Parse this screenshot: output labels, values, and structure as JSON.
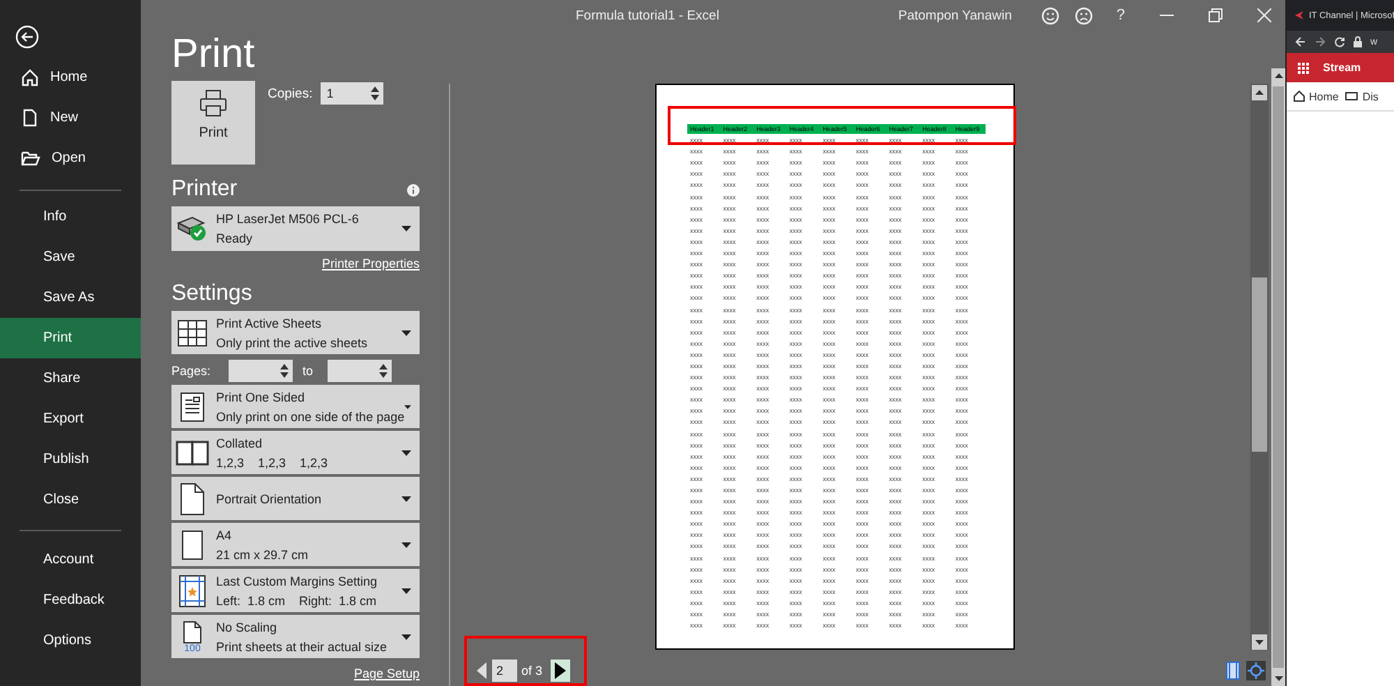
{
  "window": {
    "title": "Formula tutorial1  -  Excel",
    "user": "Patompon Yanawin",
    "help": "?"
  },
  "nav": {
    "top": [
      {
        "label": "Home",
        "selected": false
      },
      {
        "label": "New",
        "selected": false
      },
      {
        "label": "Open",
        "selected": false
      }
    ],
    "middle": [
      {
        "label": "Info",
        "selected": false
      },
      {
        "label": "Save",
        "selected": false
      },
      {
        "label": "Save As",
        "selected": false
      },
      {
        "label": "Print",
        "selected": true
      },
      {
        "label": "Share",
        "selected": false
      },
      {
        "label": "Export",
        "selected": false
      },
      {
        "label": "Publish",
        "selected": false
      },
      {
        "label": "Close",
        "selected": false
      }
    ],
    "bottom": [
      {
        "label": "Account",
        "selected": false
      },
      {
        "label": "Feedback",
        "selected": false
      },
      {
        "label": "Options",
        "selected": false
      }
    ]
  },
  "print": {
    "heading": "Print",
    "button": "Print",
    "copies_label": "Copies:",
    "copies": "1"
  },
  "printer": {
    "heading": "Printer",
    "name": "HP LaserJet M506 PCL-6",
    "status": "Ready",
    "properties_link": "Printer Properties"
  },
  "settings": {
    "heading": "Settings",
    "pages_label": "Pages:",
    "to_label": "to",
    "page_setup_link": "Page Setup",
    "items": [
      {
        "title": "Print Active Sheets",
        "subtitle": "Only print the active sheets"
      },
      {
        "title": "Print One Sided",
        "subtitle": "Only print on one side of the page"
      },
      {
        "title": "Collated",
        "subtitle": "1,2,3    1,2,3    1,2,3"
      },
      {
        "title": "Portrait Orientation"
      },
      {
        "title": "A4",
        "subtitle": "21 cm x 29.7 cm"
      },
      {
        "title": "Last Custom Margins Setting",
        "subtitle": "Left:  1.8 cm    Right:  1.8 cm"
      },
      {
        "title": "No Scaling",
        "subtitle": "Print sheets at their actual size",
        "icon_label": "100"
      }
    ]
  },
  "preview": {
    "columns": [
      "Header1",
      "Header2",
      "Header3",
      "Header4",
      "Header5",
      "Header6",
      "Header7",
      "Header8",
      "Header9"
    ],
    "rows": [
      [
        "xxxx",
        "xxxx",
        "xxxx",
        "xxxx",
        "xxxx",
        "xxxx",
        "xxxx",
        "xxxx",
        "xxxx"
      ],
      [
        "xxxx",
        "xxxx",
        "xxxx",
        "xxxx",
        "xxxx",
        "xxxx",
        "xxxx",
        "xxxx",
        "xxxx"
      ],
      [
        "xxxx",
        "xxxx",
        "xxxx",
        "xxxx",
        "xxxx",
        "xxxx",
        "xxxx",
        "xxxx",
        "xxxx"
      ],
      [
        "xxxx",
        "xxxx",
        "xxxx",
        "xxxx",
        "xxxx",
        "xxxx",
        "xxxx",
        "xxxx",
        "xxxx"
      ],
      [
        "xxxx",
        "xxxx",
        "xxxx",
        "xxxx",
        "xxxx",
        "xxxx",
        "xxxx",
        "xxxx",
        "xxxx"
      ],
      [
        "xxxx",
        "xxxx",
        "xxxx",
        "xxxx",
        "xxxx",
        "xxxx",
        "xxxx",
        "xxxx",
        "xxxx"
      ],
      [
        "xxxx",
        "xxxx",
        "xxxx",
        "xxxx",
        "xxxx",
        "xxxx",
        "xxxx",
        "xxxx",
        "xxxx"
      ],
      [
        "xxxx",
        "xxxx",
        "xxxx",
        "xxxx",
        "xxxx",
        "xxxx",
        "xxxx",
        "xxxx",
        "xxxx"
      ],
      [
        "xxxx",
        "xxxx",
        "xxxx",
        "xxxx",
        "xxxx",
        "xxxx",
        "xxxx",
        "xxxx",
        "xxxx"
      ],
      [
        "xxxx",
        "xxxx",
        "xxxx",
        "xxxx",
        "xxxx",
        "xxxx",
        "xxxx",
        "xxxx",
        "xxxx"
      ],
      [
        "xxxx",
        "xxxx",
        "xxxx",
        "xxxx",
        "xxxx",
        "xxxx",
        "xxxx",
        "xxxx",
        "xxxx"
      ],
      [
        "xxxx",
        "xxxx",
        "xxxx",
        "xxxx",
        "xxxx",
        "xxxx",
        "xxxx",
        "xxxx",
        "xxxx"
      ],
      [
        "xxxx",
        "xxxx",
        "xxxx",
        "xxxx",
        "xxxx",
        "xxxx",
        "xxxx",
        "xxxx",
        "xxxx"
      ],
      [
        "xxxx",
        "xxxx",
        "xxxx",
        "xxxx",
        "xxxx",
        "xxxx",
        "xxxx",
        "xxxx",
        "xxxx"
      ],
      [
        "xxxx",
        "xxxx",
        "xxxx",
        "xxxx",
        "xxxx",
        "xxxx",
        "xxxx",
        "xxxx",
        "xxxx"
      ],
      [
        "xxxx",
        "xxxx",
        "xxxx",
        "xxxx",
        "xxxx",
        "xxxx",
        "xxxx",
        "xxxx",
        "xxxx"
      ],
      [
        "xxxx",
        "xxxx",
        "xxxx",
        "xxxx",
        "xxxx",
        "xxxx",
        "xxxx",
        "xxxx",
        "xxxx"
      ],
      [
        "xxxx",
        "xxxx",
        "xxxx",
        "xxxx",
        "xxxx",
        "xxxx",
        "xxxx",
        "xxxx",
        "xxxx"
      ],
      [
        "xxxx",
        "xxxx",
        "xxxx",
        "xxxx",
        "xxxx",
        "xxxx",
        "xxxx",
        "xxxx",
        "xxxx"
      ],
      [
        "xxxx",
        "xxxx",
        "xxxx",
        "xxxx",
        "xxxx",
        "xxxx",
        "xxxx",
        "xxxx",
        "xxxx"
      ],
      [
        "xxxx",
        "xxxx",
        "xxxx",
        "xxxx",
        "xxxx",
        "xxxx",
        "xxxx",
        "xxxx",
        "xxxx"
      ],
      [
        "xxxx",
        "xxxx",
        "xxxx",
        "xxxx",
        "xxxx",
        "xxxx",
        "xxxx",
        "xxxx",
        "xxxx"
      ],
      [
        "xxxx",
        "xxxx",
        "xxxx",
        "xxxx",
        "xxxx",
        "xxxx",
        "xxxx",
        "xxxx",
        "xxxx"
      ],
      [
        "xxxx",
        "xxxx",
        "xxxx",
        "xxxx",
        "xxxx",
        "xxxx",
        "xxxx",
        "xxxx",
        "xxxx"
      ],
      [
        "xxxx",
        "xxxx",
        "xxxx",
        "xxxx",
        "xxxx",
        "xxxx",
        "xxxx",
        "xxxx",
        "xxxx"
      ],
      [
        "xxxx",
        "xxxx",
        "xxxx",
        "xxxx",
        "xxxx",
        "xxxx",
        "xxxx",
        "xxxx",
        "xxxx"
      ],
      [
        "xxxx",
        "xxxx",
        "xxxx",
        "xxxx",
        "xxxx",
        "xxxx",
        "xxxx",
        "xxxx",
        "xxxx"
      ],
      [
        "xxxx",
        "xxxx",
        "xxxx",
        "xxxx",
        "xxxx",
        "xxxx",
        "xxxx",
        "xxxx",
        "xxxx"
      ],
      [
        "xxxx",
        "xxxx",
        "xxxx",
        "xxxx",
        "xxxx",
        "xxxx",
        "xxxx",
        "xxxx",
        "xxxx"
      ],
      [
        "xxxx",
        "xxxx",
        "xxxx",
        "xxxx",
        "xxxx",
        "xxxx",
        "xxxx",
        "xxxx",
        "xxxx"
      ],
      [
        "xxxx",
        "xxxx",
        "xxxx",
        "xxxx",
        "xxxx",
        "xxxx",
        "xxxx",
        "xxxx",
        "xxxx"
      ],
      [
        "xxxx",
        "xxxx",
        "xxxx",
        "xxxx",
        "xxxx",
        "xxxx",
        "xxxx",
        "xxxx",
        "xxxx"
      ],
      [
        "xxxx",
        "xxxx",
        "xxxx",
        "xxxx",
        "xxxx",
        "xxxx",
        "xxxx",
        "xxxx",
        "xxxx"
      ],
      [
        "xxxx",
        "xxxx",
        "xxxx",
        "xxxx",
        "xxxx",
        "xxxx",
        "xxxx",
        "xxxx",
        "xxxx"
      ],
      [
        "xxxx",
        "xxxx",
        "xxxx",
        "xxxx",
        "xxxx",
        "xxxx",
        "xxxx",
        "xxxx",
        "xxxx"
      ],
      [
        "xxxx",
        "xxxx",
        "xxxx",
        "xxxx",
        "xxxx",
        "xxxx",
        "xxxx",
        "xxxx",
        "xxxx"
      ],
      [
        "xxxx",
        "xxxx",
        "xxxx",
        "xxxx",
        "xxxx",
        "xxxx",
        "xxxx",
        "xxxx",
        "xxxx"
      ],
      [
        "xxxx",
        "xxxx",
        "xxxx",
        "xxxx",
        "xxxx",
        "xxxx",
        "xxxx",
        "xxxx",
        "xxxx"
      ],
      [
        "xxxx",
        "xxxx",
        "xxxx",
        "xxxx",
        "xxxx",
        "xxxx",
        "xxxx",
        "xxxx",
        "xxxx"
      ],
      [
        "xxxx",
        "xxxx",
        "xxxx",
        "xxxx",
        "xxxx",
        "xxxx",
        "xxxx",
        "xxxx",
        "xxxx"
      ],
      [
        "xxxx",
        "xxxx",
        "xxxx",
        "xxxx",
        "xxxx",
        "xxxx",
        "xxxx",
        "xxxx",
        "xxxx"
      ],
      [
        "xxxx",
        "xxxx",
        "xxxx",
        "xxxx",
        "xxxx",
        "xxxx",
        "xxxx",
        "xxxx",
        "xxxx"
      ],
      [
        "xxxx",
        "xxxx",
        "xxxx",
        "xxxx",
        "xxxx",
        "xxxx",
        "xxxx",
        "xxxx",
        "xxxx"
      ],
      [
        "xxxx",
        "xxxx",
        "xxxx",
        "xxxx",
        "xxxx",
        "xxxx",
        "xxxx",
        "xxxx",
        "xxxx"
      ]
    ],
    "current_page": "2",
    "page_count": "of 3"
  },
  "browser": {
    "tab_title": "IT Channel | Microsof",
    "address": "w",
    "banner": "Stream",
    "links": [
      "Home",
      "Dis"
    ]
  }
}
